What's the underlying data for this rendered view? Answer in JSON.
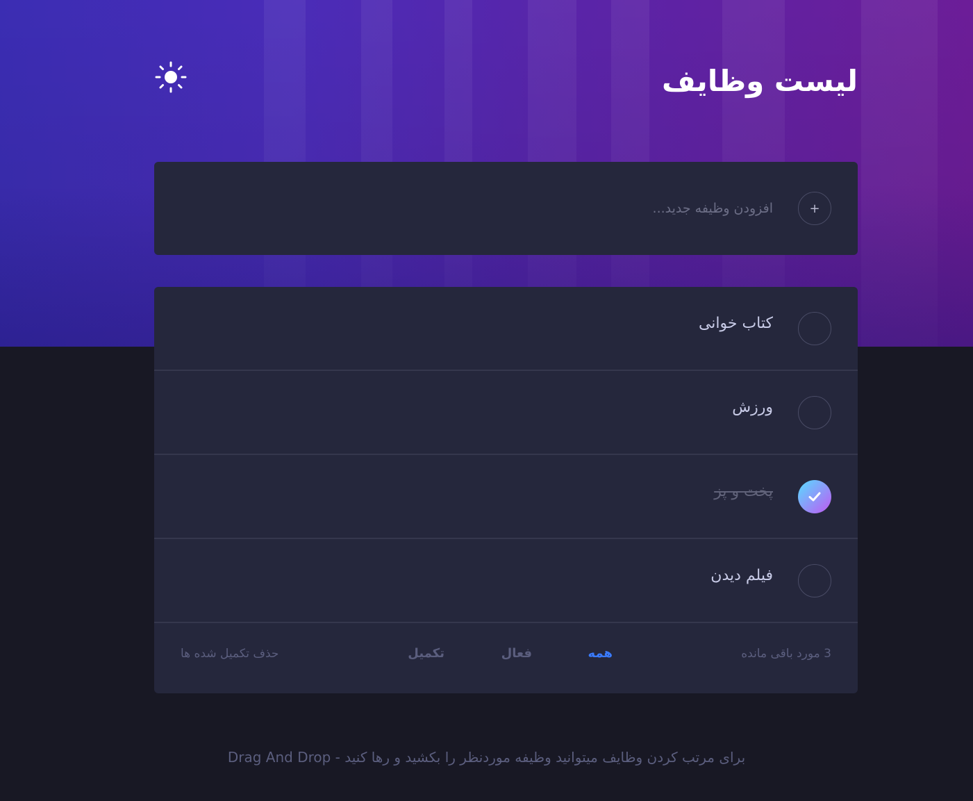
{
  "header": {
    "title": "لیست وظایف",
    "theme_icon": "sun-icon"
  },
  "new_task": {
    "placeholder": "افزودن وظیفه جدید...",
    "add_icon": "plus-icon",
    "add_symbol": "+"
  },
  "tasks": [
    {
      "label": "کتاب خوانی",
      "completed": false
    },
    {
      "label": "ورزش",
      "completed": false
    },
    {
      "label": "پخت و پز",
      "completed": true,
      "check_icon": "check-icon"
    },
    {
      "label": "فیلم دیدن",
      "completed": false
    }
  ],
  "footer": {
    "remaining": "3 مورد باقی مانده",
    "filters": [
      {
        "label": "همه",
        "active": true
      },
      {
        "label": "فعال",
        "active": false
      },
      {
        "label": "تکمیل",
        "active": false
      }
    ],
    "clear_completed": "حذف تکمیل شده ها"
  },
  "hint": "برای مرتب کردن وظایف میتوانید وظیفه موردنظر را بکشید و رها کنید - Drag And Drop",
  "colors": {
    "background": "#181824",
    "card": "#25273c",
    "accent": "#3a7bfd",
    "check_gradient_start": "#57ddff",
    "check_gradient_end": "#c058f3"
  }
}
